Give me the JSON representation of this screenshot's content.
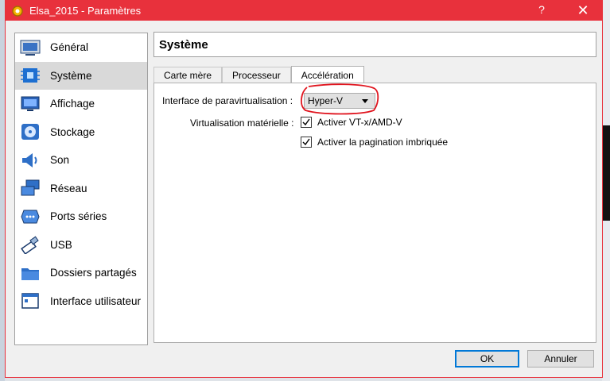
{
  "window": {
    "title": "Elsa_2015 - Paramètres",
    "help_glyph": "?",
    "close_glyph": "✕"
  },
  "sidebar": {
    "items": [
      {
        "label": "Général",
        "icon": "general-icon"
      },
      {
        "label": "Système",
        "icon": "system-chip-icon",
        "active": true
      },
      {
        "label": "Affichage",
        "icon": "display-monitor-icon"
      },
      {
        "label": "Stockage",
        "icon": "storage-disc-icon"
      },
      {
        "label": "Son",
        "icon": "speaker-icon"
      },
      {
        "label": "Réseau",
        "icon": "network-icon"
      },
      {
        "label": "Ports séries",
        "icon": "serial-port-icon"
      },
      {
        "label": "USB",
        "icon": "usb-icon"
      },
      {
        "label": "Dossiers partagés",
        "icon": "shared-folder-icon"
      },
      {
        "label": "Interface utilisateur",
        "icon": "user-interface-icon"
      }
    ]
  },
  "header": {
    "title": "Système"
  },
  "tabs": [
    {
      "label": "Carte mère"
    },
    {
      "label": "Processeur"
    },
    {
      "label": "Accélération",
      "active": true
    }
  ],
  "acceleration": {
    "paravirt_label": "Interface de paravirtualisation :",
    "paravirt_value": "Hyper-V",
    "hwvirt_label": "Virtualisation matérielle :",
    "vtx_label": "Activer VT-x/AMD-V",
    "vtx_checked": true,
    "nested_label": "Activer la pagination imbriquée",
    "nested_checked": true
  },
  "buttons": {
    "ok": "OK",
    "cancel": "Annuler"
  },
  "colors": {
    "titlebar": "#e8313c",
    "annotation": "#e0141e",
    "active_item": "#d9d9d9"
  }
}
